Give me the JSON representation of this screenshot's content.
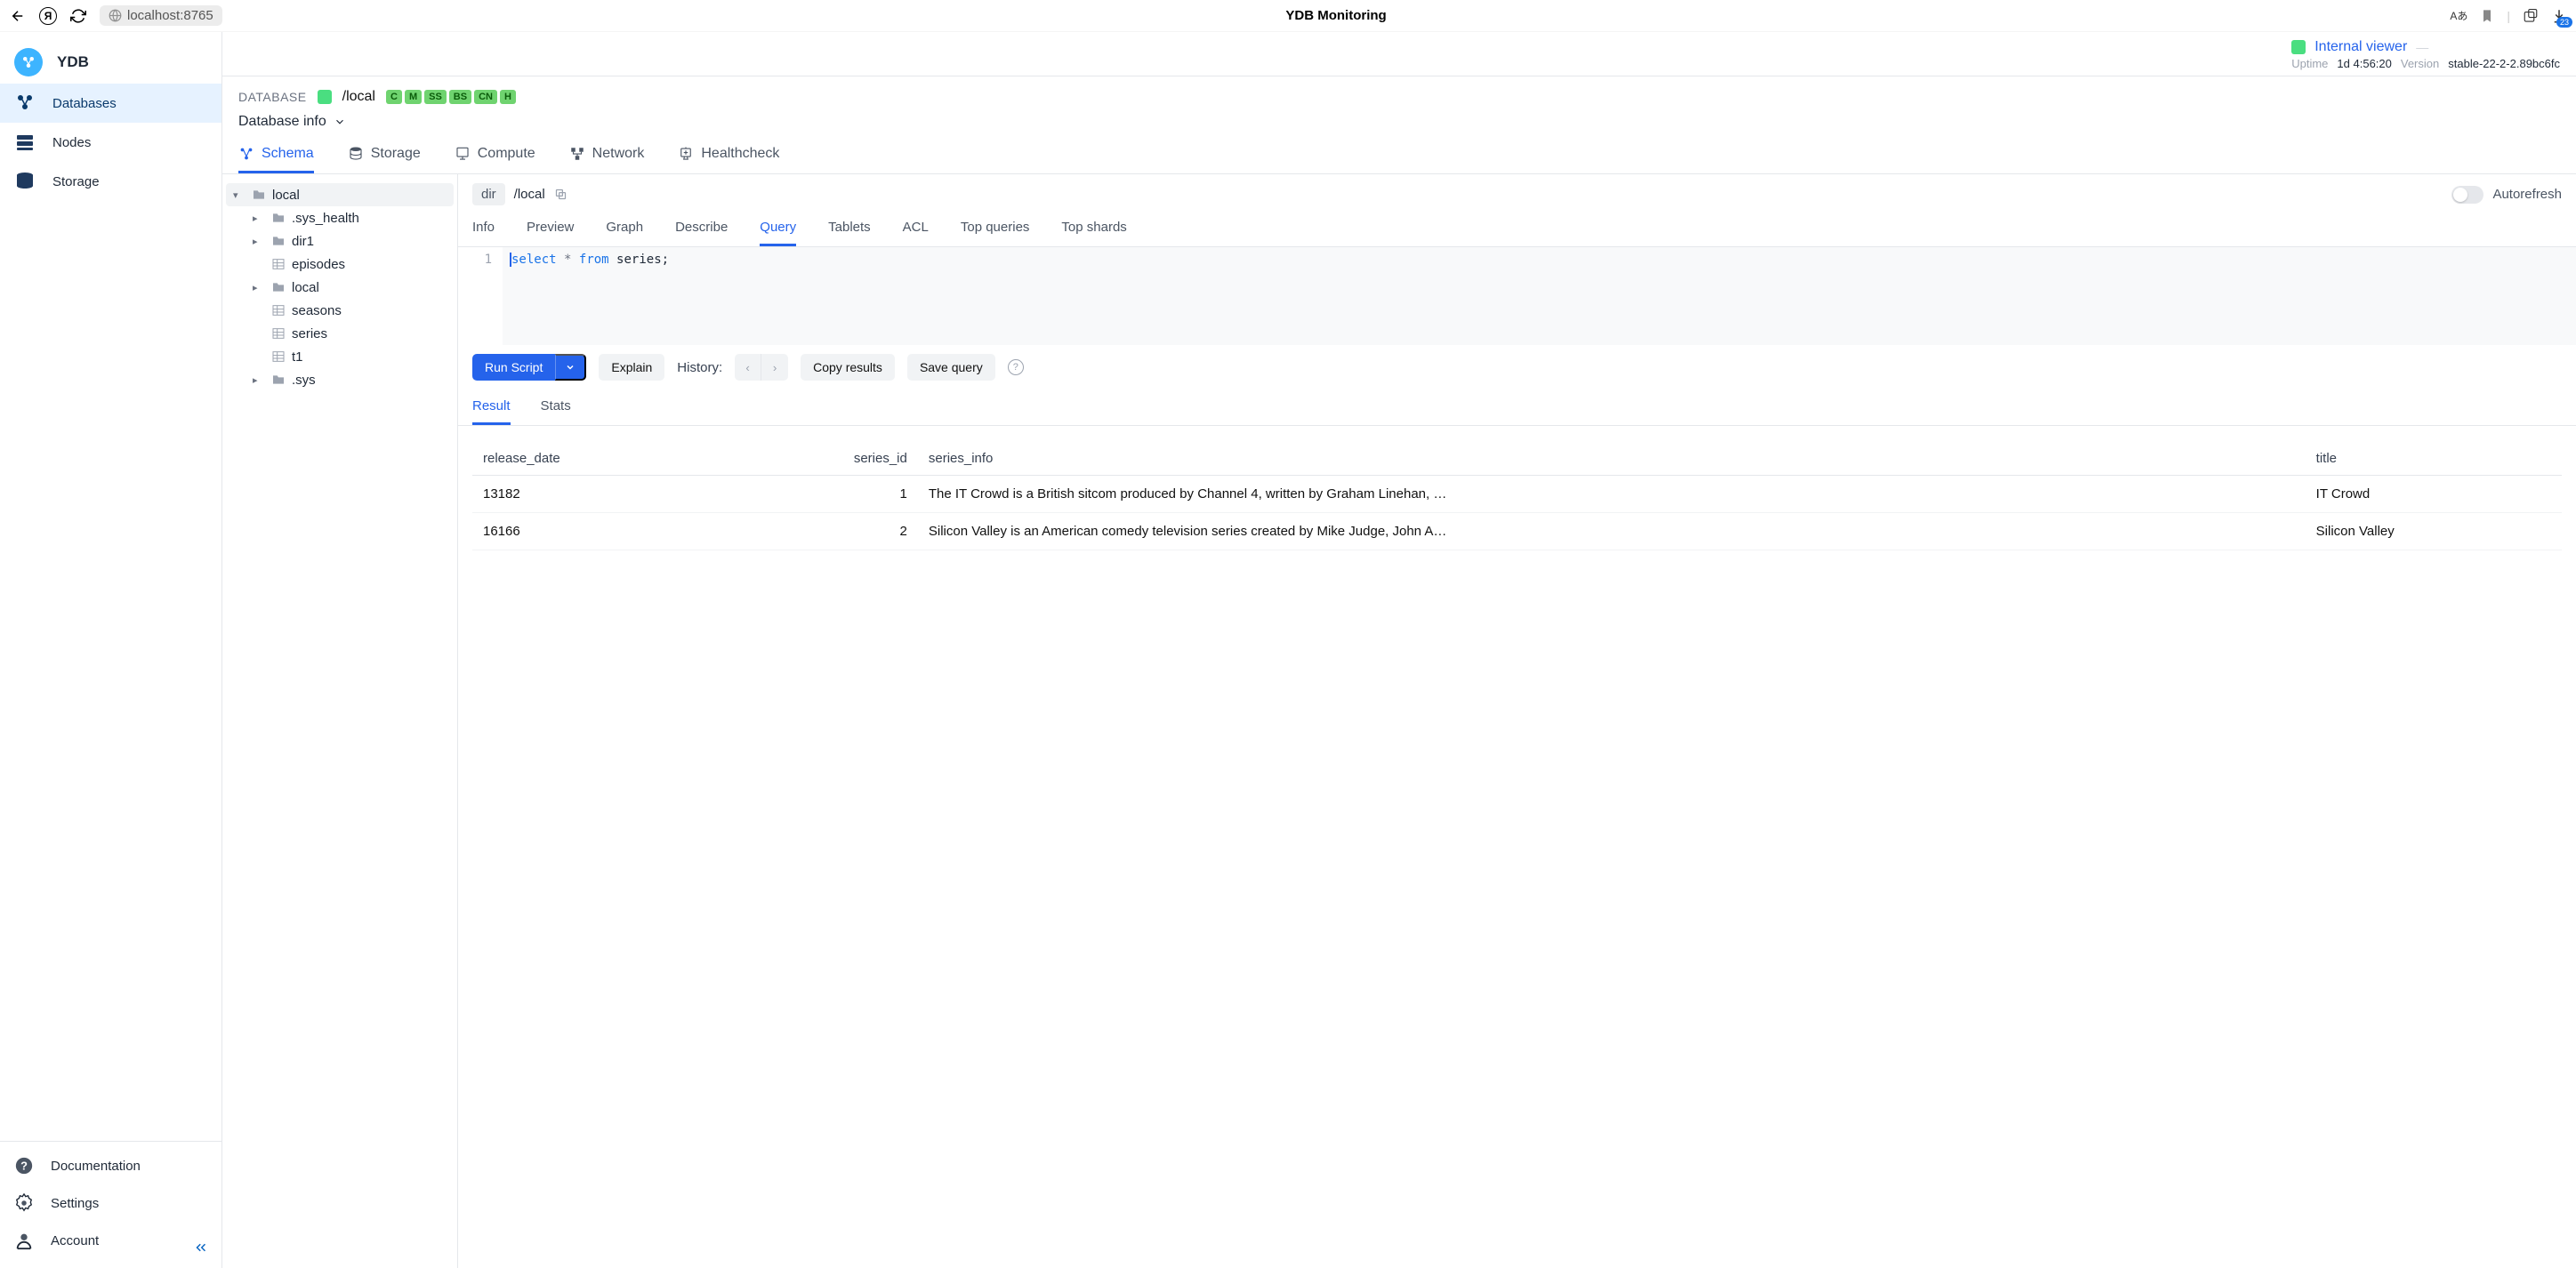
{
  "browser": {
    "address": "localhost:8765",
    "title": "YDB Monitoring",
    "badge_count": "23"
  },
  "brand": "YDB",
  "sidebar": {
    "items": [
      {
        "label": "Databases",
        "active": true
      },
      {
        "label": "Nodes",
        "active": false
      },
      {
        "label": "Storage",
        "active": false
      }
    ],
    "footer": [
      {
        "label": "Documentation"
      },
      {
        "label": "Settings"
      },
      {
        "label": "Account"
      }
    ]
  },
  "header": {
    "viewer_label": "Internal viewer",
    "uptime_label": "Uptime",
    "uptime_value": "1d 4:56:20",
    "version_label": "Version",
    "version_value": "stable-22-2-2.89bc6fc"
  },
  "db": {
    "label": "DATABASE",
    "path": "/local",
    "tags": [
      "C",
      "M",
      "SS",
      "BS",
      "CN",
      "H"
    ],
    "info_label": "Database info"
  },
  "main_tabs": [
    "Schema",
    "Storage",
    "Compute",
    "Network",
    "Healthcheck"
  ],
  "active_main_tab": 0,
  "tree": {
    "root": "local",
    "children": [
      {
        "label": ".sys_health",
        "type": "folder",
        "expandable": true
      },
      {
        "label": "dir1",
        "type": "folder",
        "expandable": true
      },
      {
        "label": "episodes",
        "type": "table",
        "expandable": false
      },
      {
        "label": "local",
        "type": "folder",
        "expandable": true
      },
      {
        "label": "seasons",
        "type": "table",
        "expandable": false
      },
      {
        "label": "series",
        "type": "table",
        "expandable": false
      },
      {
        "label": "t1",
        "type": "table",
        "expandable": false
      },
      {
        "label": ".sys",
        "type": "folder",
        "expandable": true
      }
    ]
  },
  "path_bar": {
    "type": "dir",
    "path": "/local",
    "autorefresh": "Autorefresh"
  },
  "sub_tabs": [
    "Info",
    "Preview",
    "Graph",
    "Describe",
    "Query",
    "Tablets",
    "ACL",
    "Top queries",
    "Top shards"
  ],
  "active_sub_tab": 4,
  "editor": {
    "line": "1",
    "query_kw1": "select",
    "query_op": "*",
    "query_kw2": "from",
    "query_ident": "series;"
  },
  "actions": {
    "run": "Run Script",
    "explain": "Explain",
    "history_label": "History:",
    "copy": "Copy results",
    "save": "Save query"
  },
  "result_tabs": [
    "Result",
    "Stats"
  ],
  "active_result_tab": 0,
  "table": {
    "columns": [
      "release_date",
      "series_id",
      "series_info",
      "title"
    ],
    "rows": [
      {
        "release_date": "13182",
        "series_id": "1",
        "series_info": "The IT Crowd is a British sitcom produced by Channel 4, written by Graham Linehan, …",
        "title": "IT Crowd"
      },
      {
        "release_date": "16166",
        "series_id": "2",
        "series_info": "Silicon Valley is an American comedy television series created by Mike Judge, John A…",
        "title": "Silicon Valley"
      }
    ]
  }
}
